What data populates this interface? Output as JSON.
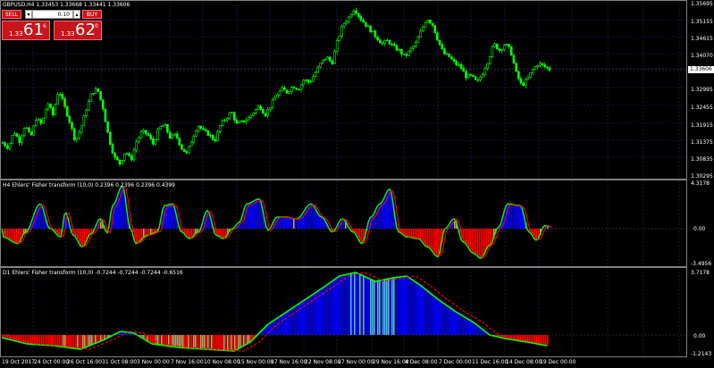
{
  "colors": {
    "background": "#000000",
    "candle_green": "#00ff00",
    "grid": "#1e2a78",
    "hist_up": "#0000ff",
    "hist_down": "#ff0000",
    "hist_neutral": "#c8a060",
    "line_green": "#00ff00",
    "line_red": "#ff0000",
    "button_red": "#c8151b"
  },
  "main_chart": {
    "title": "GBPUSD,H4  1.33453 1.33668 1.33441 1.33606",
    "price_axis": [
      "1.35695",
      "1.35155",
      "1.34615",
      "1.34070",
      "1.33606",
      "1.32995",
      "1.32455",
      "1.31915",
      "1.31375",
      "1.30835",
      "1.30295"
    ],
    "current_price": "1.33606"
  },
  "trade_panel": {
    "sell_label": "SELL",
    "buy_label": "BUY",
    "quantity": "0.10",
    "sell_price_prefix": "1.33",
    "sell_price_big": "61",
    "sell_price_sup": "6",
    "buy_price_prefix": "1.33",
    "buy_price_big": "62",
    "buy_price_sup": "0"
  },
  "indicator_h4": {
    "title": "H4 Ehlers' Fisher transform (10,0) 0.2396 0.2396 0.2396 0.4399",
    "axis": [
      "4.3178",
      "0.00",
      "-3.4956"
    ]
  },
  "indicator_d1": {
    "title": "D1 Ehlers' Fisher transform (10,0) -0.7244 -0.7244 -0.7244 -0.6516",
    "axis": [
      "3.7178",
      "0.00",
      "-1.2143"
    ]
  },
  "time_axis": [
    "19 Oct 2017",
    "24 Oct 00:00",
    "26 Oct 16:00",
    "31 Oct 08:00",
    "3 Nov 00:00",
    "7 Nov 16:00",
    "10 Nov 08:00",
    "15 Nov 00:00",
    "17 Nov 16:00",
    "22 Nov 08:00",
    "27 Nov 00:00",
    "29 Nov 16:00",
    "4 Dec 08:00",
    "7 Dec 00:00",
    "11 Dec 16:00",
    "14 Dec 08:00",
    "19 Dec 00:00"
  ],
  "chart_data": {
    "type": "candlestick",
    "symbol": "GBPUSD,H4",
    "ylim": [
      1.30295,
      1.35695
    ],
    "close_path": [
      1.3135,
      1.312,
      1.317,
      1.314,
      1.319,
      1.315,
      1.321,
      1.319,
      1.326,
      1.322,
      1.33,
      1.325,
      1.32,
      1.314,
      1.318,
      1.324,
      1.329,
      1.33,
      1.324,
      1.315,
      1.309,
      1.307,
      1.311,
      1.308,
      1.314,
      1.317,
      1.316,
      1.313,
      1.318,
      1.319,
      1.315,
      1.316,
      1.312,
      1.31,
      1.315,
      1.319,
      1.317,
      1.316,
      1.314,
      1.319,
      1.321,
      1.323,
      1.319,
      1.32,
      1.321,
      1.323,
      1.325,
      1.322,
      1.325,
      1.328,
      1.33,
      1.329,
      1.331,
      1.33,
      1.333,
      1.332,
      1.335,
      1.338,
      1.34,
      1.338,
      1.345,
      1.35,
      1.352,
      1.355,
      1.352,
      1.35,
      1.348,
      1.346,
      1.344,
      1.345,
      1.343,
      1.342,
      1.34,
      1.342,
      1.344,
      1.348,
      1.352,
      1.35,
      1.345,
      1.341,
      1.34,
      1.338,
      1.337,
      1.334,
      1.334,
      1.332,
      1.335,
      1.339,
      1.344,
      1.342,
      1.344,
      1.342,
      1.335,
      1.331,
      1.333,
      1.336,
      1.338,
      1.337,
      1.3361
    ]
  }
}
